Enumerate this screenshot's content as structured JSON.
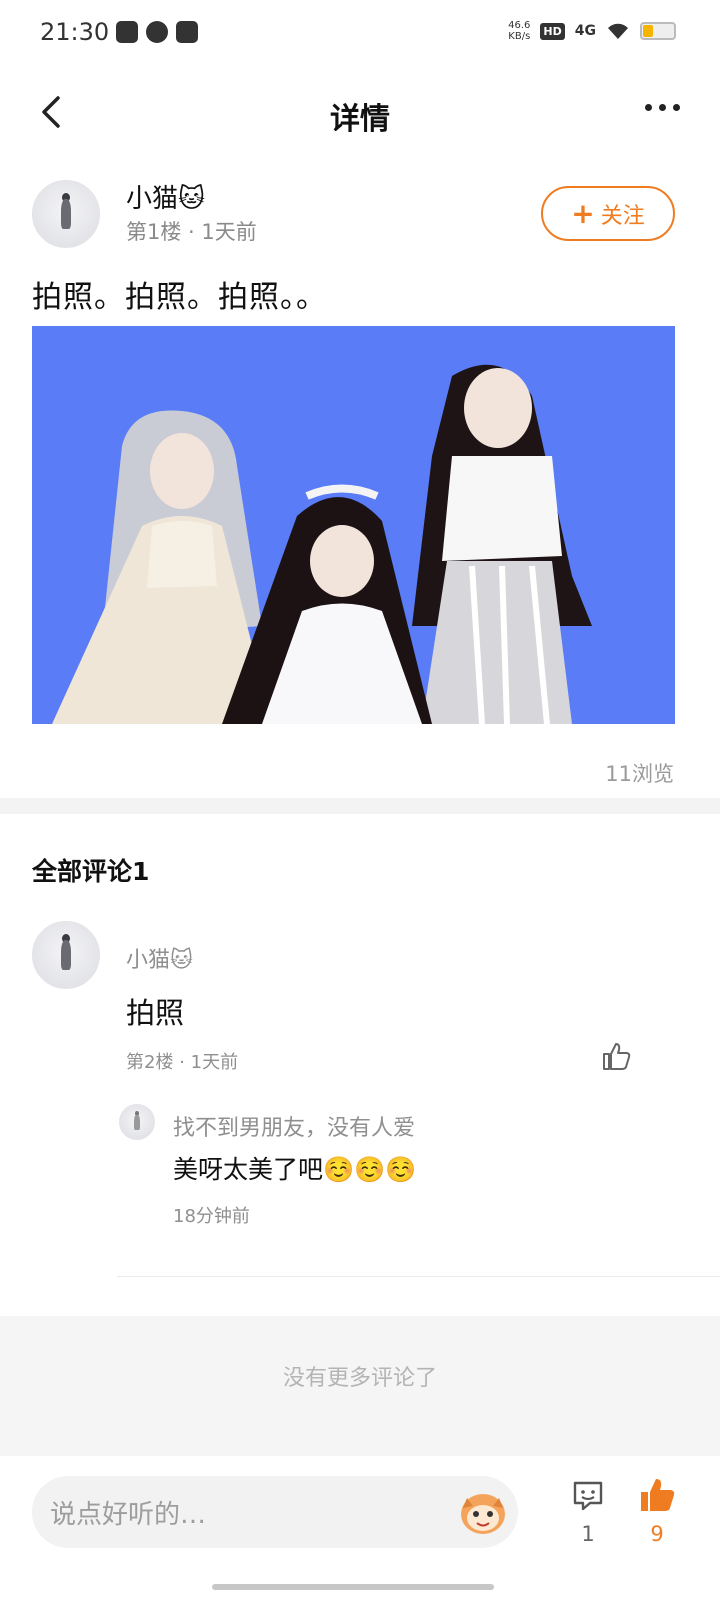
{
  "status_bar": {
    "time": "21:30",
    "net_speed_value": "46.6",
    "net_speed_unit": "KB/s",
    "hd_badge": "HD",
    "signal": "4G",
    "battery_level": 0.3
  },
  "nav": {
    "title": "详情"
  },
  "post": {
    "author": "小猫🐱",
    "meta": "第1楼 · 1天前",
    "follow_label": "关注",
    "text": "拍照。拍照。拍照。。",
    "views": "11浏览"
  },
  "comments": {
    "title": "全部评论1",
    "items": [
      {
        "author": "小猫🐱",
        "text": "拍照",
        "meta": "第2楼 · 1天前",
        "replies": [
          {
            "author": "找不到男朋友，没有人爱",
            "text": "美呀太美了吧☺️☺️☺️",
            "time": "18分钟前"
          }
        ]
      }
    ],
    "no_more": "没有更多评论了"
  },
  "bottom_bar": {
    "input_placeholder": "说点好听的…",
    "comment_count": "1",
    "like_count": "9"
  },
  "colors": {
    "accent": "#f07c22",
    "image_background": "#5a7cf6"
  }
}
